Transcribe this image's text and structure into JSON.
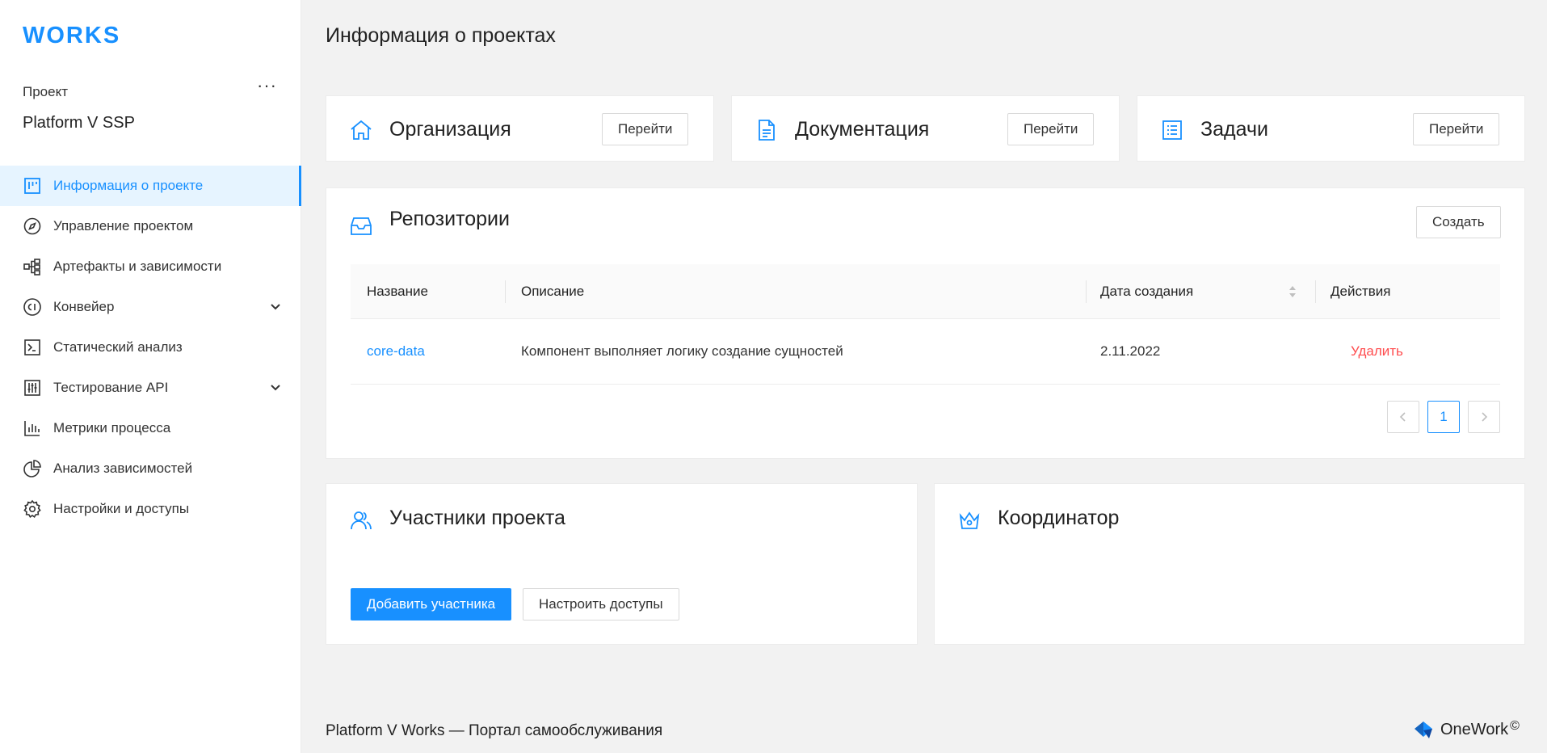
{
  "app": {
    "logo": "WORKS"
  },
  "sidebar": {
    "project_label": "Проект",
    "project_more": "···",
    "project_name": "Platform V SSP",
    "items": [
      {
        "label": "Информация о проекте",
        "icon": "board-icon",
        "active": true
      },
      {
        "label": "Управление проектом",
        "icon": "compass-icon"
      },
      {
        "label": "Артефакты и зависимости",
        "icon": "hierarchy-icon"
      },
      {
        "label": "Конвейер",
        "icon": "ci-icon",
        "expandable": true
      },
      {
        "label": "Статический анализ",
        "icon": "terminal-icon"
      },
      {
        "label": "Тестирование API",
        "icon": "sliders-icon",
        "expandable": true
      },
      {
        "label": "Метрики процесса",
        "icon": "bar-chart-icon"
      },
      {
        "label": "Анализ зависимостей",
        "icon": "pie-chart-icon"
      },
      {
        "label": "Настройки и доступы",
        "icon": "gear-icon"
      }
    ]
  },
  "main": {
    "title": "Информация о проектах",
    "org": {
      "title": "Организация",
      "button": "Перейти",
      "icon": "home-icon"
    },
    "docs": {
      "title": "Документация",
      "button": "Перейти",
      "icon": "document-icon"
    },
    "tasks": {
      "title": "Задачи",
      "button": "Перейти",
      "icon": "list-icon"
    },
    "repos": {
      "title": "Репозитории",
      "icon": "inbox-icon",
      "create_button": "Создать",
      "columns": [
        "Название",
        "Описание",
        "Дата создания",
        "Действия"
      ],
      "rows": [
        {
          "name": "core-data",
          "description": "Компонент выполняет логику создание сущностей",
          "date": "2.11.2022",
          "action": "Удалить"
        }
      ],
      "pagination": {
        "prev": "<",
        "current": "1",
        "next": ">"
      }
    },
    "members": {
      "title": "Участники проекта",
      "icon": "users-icon",
      "add_button": "Добавить участника",
      "access_button": "Настроить доступы"
    },
    "coordinator": {
      "title": "Координатор",
      "icon": "crown-icon"
    }
  },
  "footer": {
    "text": "Platform V Works — Портал самообслуживания",
    "brand": "OneWork",
    "brand_mark": "©"
  },
  "colors": {
    "accent": "#1890ff",
    "danger": "#ff4d4f",
    "background": "#f2f2f2"
  }
}
